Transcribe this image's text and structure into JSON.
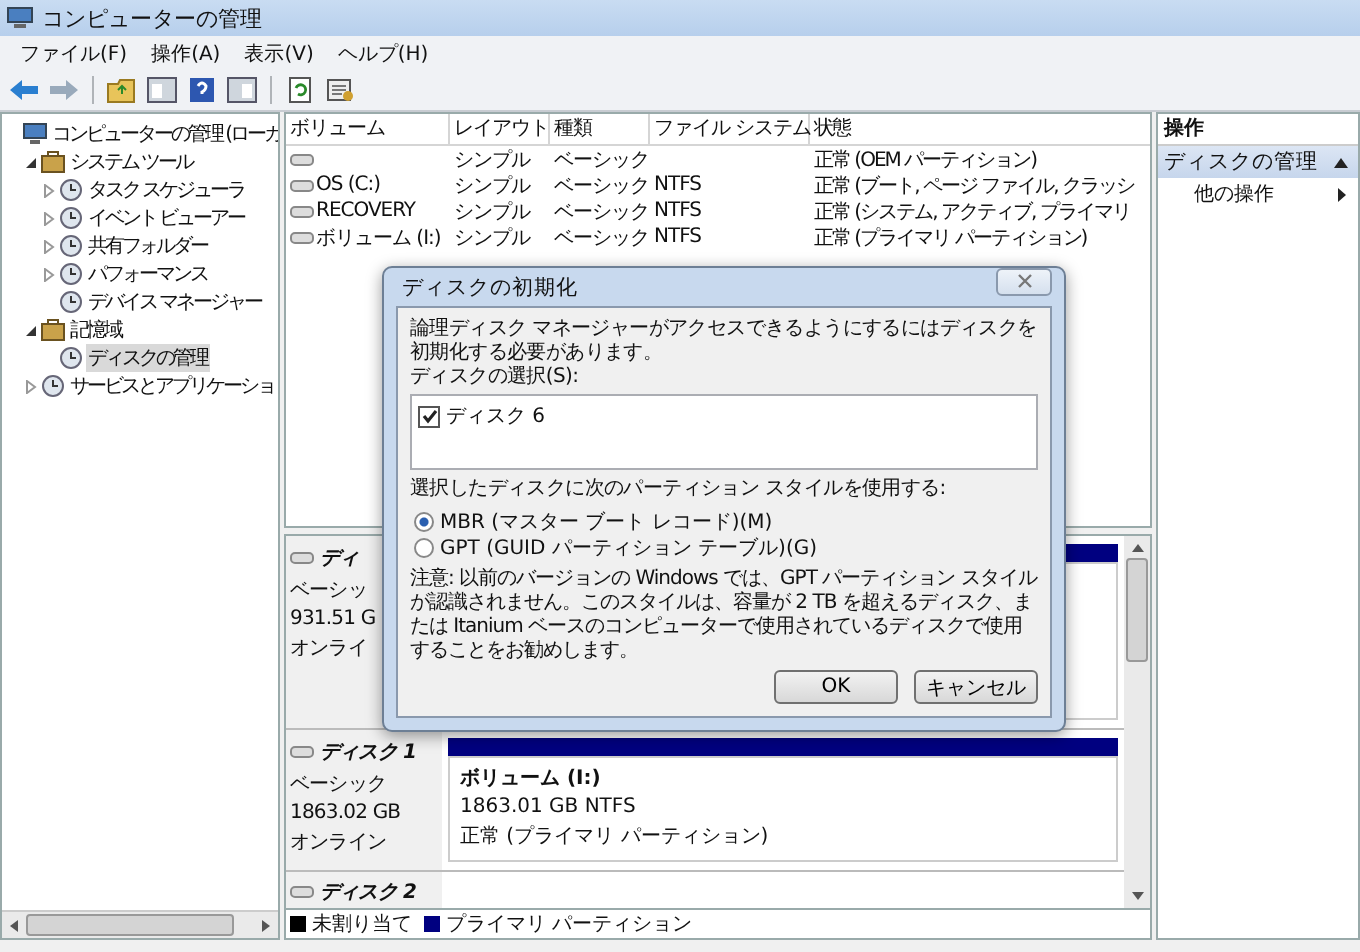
{
  "window": {
    "title": "コンピューターの管理"
  },
  "menu": [
    "ファイル(F)",
    "操作(A)",
    "表示(V)",
    "ヘルプ(H)"
  ],
  "tree": [
    {
      "label": "コンピューターの管理 (ローカ",
      "selected": false,
      "children": [
        {
          "label": "システム ツール",
          "selected": false,
          "expanded": true,
          "children": [
            {
              "label": "タスク スケジューラ",
              "selected": false,
              "expanded": false
            },
            {
              "label": "イベント ビューアー",
              "selected": false,
              "expanded": false
            },
            {
              "label": "共有フォルダー",
              "selected": false,
              "expanded": false
            },
            {
              "label": "パフォーマンス",
              "selected": false,
              "expanded": false
            },
            {
              "label": "デバイス マネージャー",
              "selected": false
            }
          ]
        },
        {
          "label": "記憶域",
          "selected": false,
          "expanded": true,
          "children": [
            {
              "label": "ディスクの管理",
              "selected": true
            }
          ]
        },
        {
          "label": "サービスとアプリケーショ",
          "selected": false,
          "expanded": false
        }
      ]
    }
  ],
  "volume_table": {
    "columns": [
      "ボリューム",
      "レイアウト",
      "種類",
      "ファイル システム",
      "状態"
    ],
    "rows": [
      {
        "layout": "シンプル",
        "type": "ベーシック",
        "status": "正常 (OEM パーティション)"
      },
      {
        "volume": "OS (C:)",
        "layout": "シンプル",
        "type": "ベーシック",
        "filesystem": "NTFS",
        "status": "正常 (ブート, ページ ファイル, クラッシ"
      },
      {
        "volume": "RECOVERY",
        "layout": "シンプル",
        "type": "ベーシック",
        "filesystem": "NTFS",
        "status": "正常 (システム, アクティブ, プライマリ"
      },
      {
        "volume": "ボリューム (I:)",
        "layout": "シンプル",
        "type": "ベーシック",
        "filesystem": "NTFS",
        "status": "正常 (プライマリ パーティション)"
      }
    ]
  },
  "disks": [
    {
      "name": "ディ",
      "type": "ベーシッ",
      "size": "931.51 G",
      "status": "オンライ"
    },
    {
      "name": "ディスク 1",
      "type": "ベーシック",
      "size": "1863.02 GB",
      "status": "オンライン",
      "partition": {
        "name": "ボリューム (I:)",
        "size": "1863.01 GB NTFS",
        "status": "正常 (プライマリ パーティション)"
      }
    },
    {
      "name": "ディスク 2"
    }
  ],
  "legend": [
    {
      "label": "未割り当て",
      "color": "#000000"
    },
    {
      "label": "プライマリ パーティション",
      "color": "#000080"
    }
  ],
  "actions": {
    "header": "操作",
    "sections": [
      {
        "title": "ディスクの管理",
        "expanded": true,
        "items": [
          "他の操作"
        ]
      }
    ]
  },
  "dialog": {
    "title": "ディスクの初期化",
    "message": "論理ディスク マネージャーがアクセスできるようにするにはディスクを初期化する必要があります。",
    "select_label": "ディスクの選択(S):",
    "disks": [
      {
        "label": "ディスク 6",
        "checked": true
      }
    ],
    "style_label": "選択したディスクに次のパーティション スタイルを使用する:",
    "options": [
      {
        "label": "MBR (マスター ブート レコード)(M)",
        "selected": true
      },
      {
        "label": "GPT (GUID パーティション テーブル)(G)",
        "selected": false
      }
    ],
    "note": "注意: 以前のバージョンの Windows では、GPT パーティション スタイルが認識されません。このスタイルは、容量が 2 TB を超えるディスク、または Itanium ベースのコンピューターで使用されているディスクで使用することをお勧めします。",
    "buttons": [
      "OK",
      "キャンセル"
    ]
  }
}
